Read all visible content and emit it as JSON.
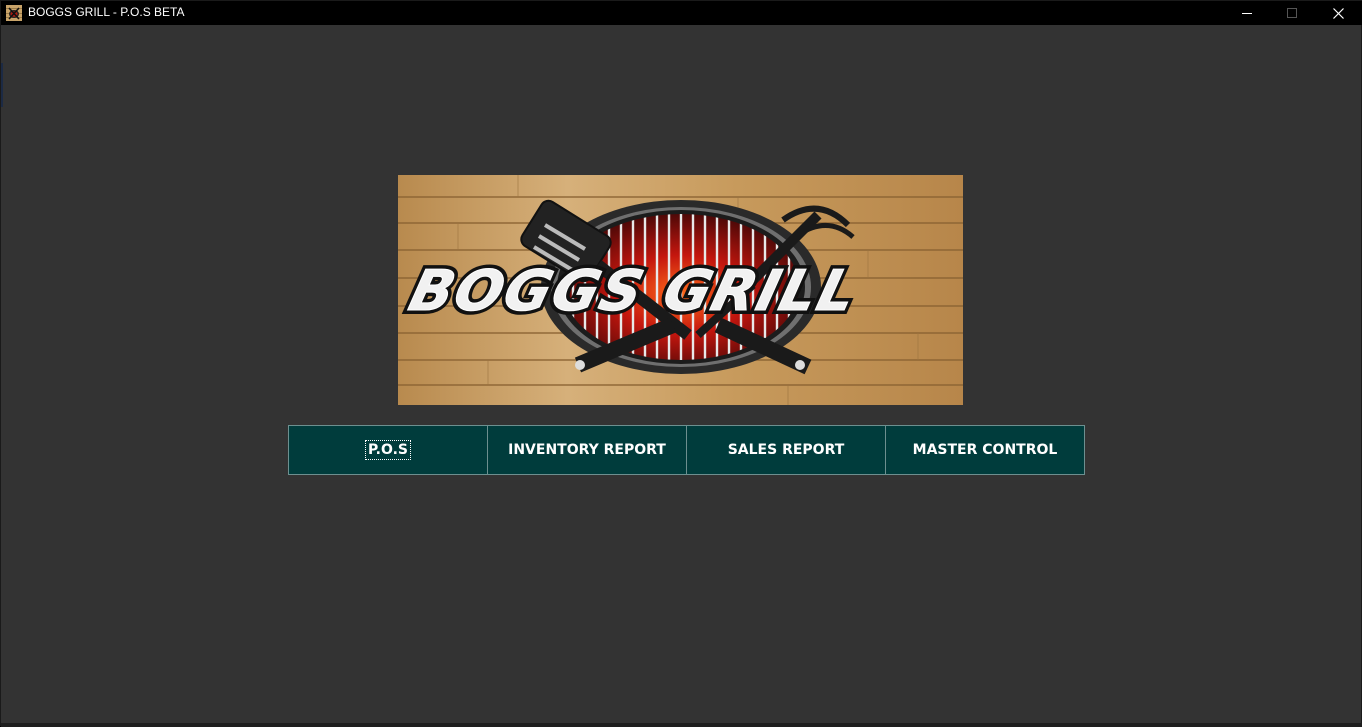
{
  "window": {
    "title": "BOGGS GRILL - P.O.S BETA",
    "background_color": "#333333",
    "controls": {
      "minimize_icon": "minimize-icon",
      "maximize_icon": "maximize-icon",
      "close_icon": "close-icon"
    }
  },
  "logo": {
    "text": "BOGGS GRILL",
    "alt": "BOGGS GRILL logo"
  },
  "nav": {
    "accent_color": "#003c3c",
    "buttons": [
      {
        "label": "P.O.S",
        "focused": true
      },
      {
        "label": "INVENTORY REPORT",
        "focused": false
      },
      {
        "label": "SALES REPORT",
        "focused": false
      },
      {
        "label": "MASTER CONTROL",
        "focused": false
      }
    ]
  }
}
